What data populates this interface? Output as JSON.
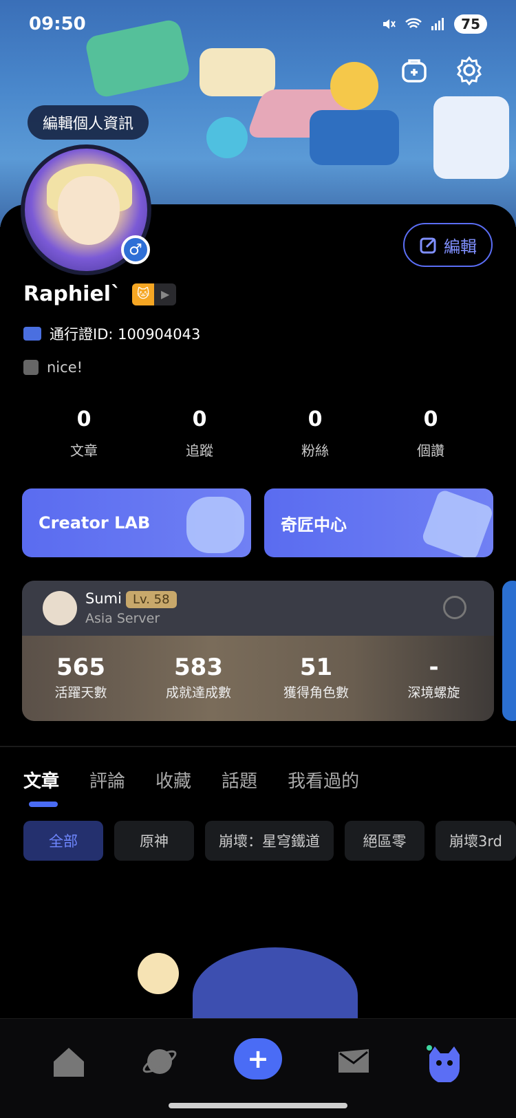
{
  "status_bar": {
    "time": "09:50",
    "battery": "75"
  },
  "header": {
    "edit_info_label": "編輯個人資訊",
    "edit_button_label": "編輯"
  },
  "profile": {
    "username": "Raphiel`",
    "pass_id": "通行證ID: 100904043",
    "bio": "nice!"
  },
  "stats": [
    {
      "value": "0",
      "label": "文章"
    },
    {
      "value": "0",
      "label": "追蹤"
    },
    {
      "value": "0",
      "label": "粉絲"
    },
    {
      "value": "0",
      "label": "個讚"
    }
  ],
  "promos": [
    {
      "label": "Creator LAB"
    },
    {
      "label": "奇匠中心"
    }
  ],
  "game_card": {
    "name": "Sumi",
    "level": "Lv. 58",
    "server": "Asia Server",
    "stats": [
      {
        "value": "565",
        "label": "活躍天數"
      },
      {
        "value": "583",
        "label": "成就達成數"
      },
      {
        "value": "51",
        "label": "獲得角色數"
      },
      {
        "value": "-",
        "label": "深境螺旋"
      }
    ]
  },
  "tabs": [
    "文章",
    "評論",
    "收藏",
    "話題",
    "我看過的"
  ],
  "chips": [
    "全部",
    "原神",
    "崩壞：星穹鐵道",
    "絕區零",
    "崩壞3rd"
  ],
  "colors": {
    "accent": "#4a6cf5",
    "background": "#000000",
    "level_badge": "#c8a86b"
  },
  "nav_icons": [
    "home-icon",
    "planet-icon",
    "plus-icon",
    "mail-icon",
    "profile-icon"
  ]
}
